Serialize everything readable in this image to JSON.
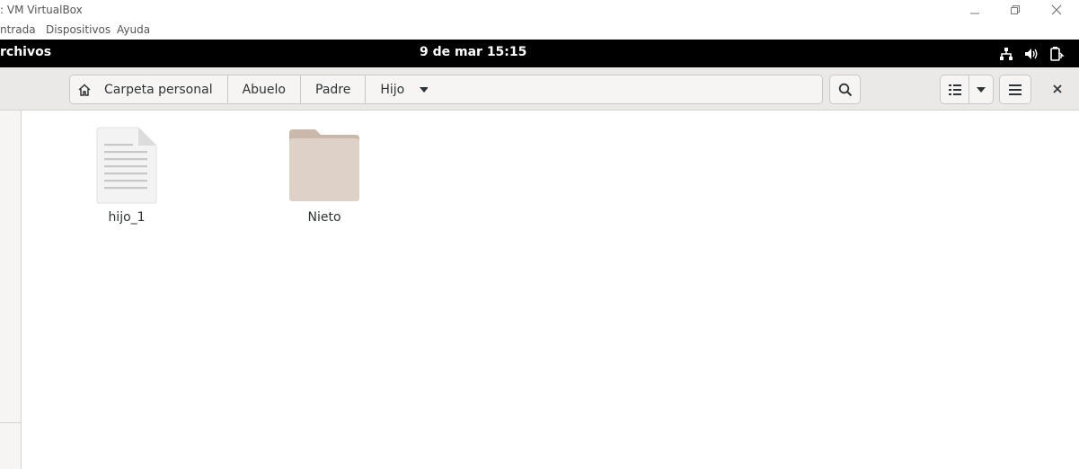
{
  "vbox": {
    "title": ": VM VirtualBox",
    "menu": [
      "ntrada",
      "Dispositivos",
      "Ayuda"
    ]
  },
  "topbar": {
    "app_name": "rchivos",
    "clock": "9 de mar  15:15"
  },
  "header": {
    "path": [
      "Carpeta personal",
      "Abuelo",
      "Padre",
      "Hijo"
    ]
  },
  "files": [
    {
      "name": "hijo_1",
      "icon": "text-file-icon"
    },
    {
      "name": "Nieto",
      "icon": "folder-icon"
    }
  ]
}
